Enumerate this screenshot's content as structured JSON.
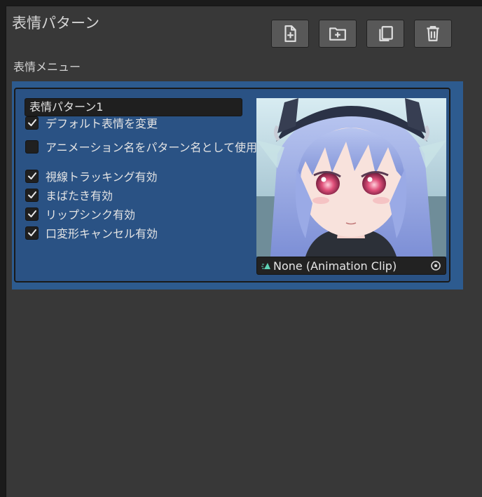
{
  "window": {
    "title": "表情パターン"
  },
  "toolbar": {
    "buttons": [
      {
        "icon": "new-file-icon"
      },
      {
        "icon": "new-folder-icon"
      },
      {
        "icon": "duplicate-icon"
      },
      {
        "icon": "delete-icon"
      }
    ]
  },
  "section": {
    "label": "表情メニュー"
  },
  "pattern": {
    "name_value": "表情パターン1",
    "options": [
      {
        "label": "デフォルト表情を変更",
        "checked": true
      },
      {
        "label": "アニメーション名をパターン名として使用",
        "checked": false
      },
      {
        "label": "視線トラッキング有効",
        "checked": true
      },
      {
        "label": "まばたき有効",
        "checked": true
      },
      {
        "label": "リップシンク有効",
        "checked": true
      },
      {
        "label": "口変形キャンセル有効",
        "checked": true
      }
    ],
    "clip_field": {
      "value": "None (Animation Clip)",
      "icon": "animation-clip-icon",
      "picker_icon": "object-picker-icon"
    }
  },
  "colors": {
    "panel_selected": "#2d5b8f",
    "card": "#2a5284",
    "window_bg": "#383838",
    "clip_icon": "#5fd3b5"
  }
}
